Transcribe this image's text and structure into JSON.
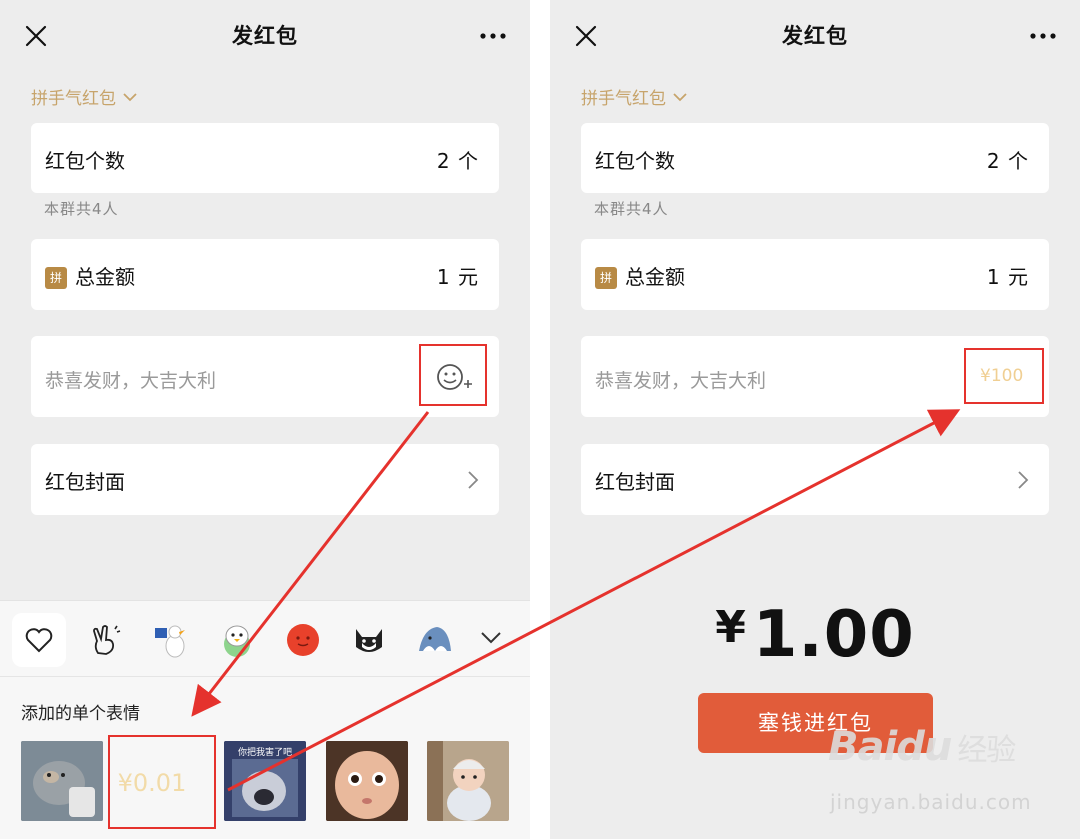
{
  "left": {
    "title": "发红包",
    "type_label": "拼手气红包",
    "count": {
      "label": "红包个数",
      "value": "2 个"
    },
    "group_hint": "本群共4人",
    "total": {
      "badge": "拼",
      "label": "总金额",
      "value": "1 元"
    },
    "greeting_placeholder": "恭喜发财，大吉大利",
    "cover": {
      "label": "红包封面"
    },
    "emoji_section_title": "添加的单个表情",
    "stickers": [
      {
        "name": "cat-sticker"
      },
      {
        "name": "money-sticker",
        "text": "¥0.01"
      },
      {
        "name": "meme-sticker",
        "caption": "你把我害了吧"
      },
      {
        "name": "baby-face-sticker"
      },
      {
        "name": "toddler-sticker"
      }
    ]
  },
  "right": {
    "title": "发红包",
    "type_label": "拼手气红包",
    "count": {
      "label": "红包个数",
      "value": "2 个"
    },
    "group_hint": "本群共4人",
    "total": {
      "badge": "拼",
      "label": "总金额",
      "value": "1 元"
    },
    "greeting_placeholder": "恭喜发财，大吉大利",
    "selected_sticker_text": "¥100",
    "cover": {
      "label": "红包封面"
    },
    "amount": {
      "currency": "¥",
      "value": "1.00"
    },
    "pay_button": "塞钱进红包"
  },
  "watermark": {
    "logo_text": "Baidu",
    "logo_sub": "经验",
    "url": "jingyan.baidu.com"
  },
  "colors": {
    "accent_gold": "#c7a46b",
    "pay_button": "#e15c3a",
    "highlight_red": "#e5322d",
    "background": "#ededed"
  }
}
